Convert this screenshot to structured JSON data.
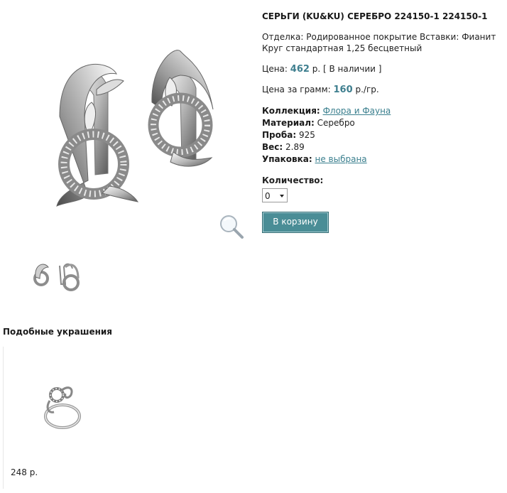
{
  "product": {
    "title": "СЕРЬГИ (KU&KU) СЕРЕБРО 224150-1 224150-1",
    "description": "Отделка: Родированное покрытие Вставки: Фианит Круг стандартная 1,25 бесцветный",
    "price_label": "Цена:",
    "price_value": "462",
    "price_unit": "р.",
    "availability": "[ В наличии ]",
    "per_gram_label": "Цена за грамм:",
    "per_gram_value": "160",
    "per_gram_unit": "р./гр."
  },
  "properties": {
    "collection_label": "Коллекция:",
    "collection_value": "Флора и Фауна",
    "material_label": "Материал:",
    "material_value": "Серебро",
    "probe_label": "Проба:",
    "probe_value": "925",
    "weight_label": "Вес:",
    "weight_value": "2.89",
    "package_label": "Упаковка:",
    "package_value": "не выбрана"
  },
  "order": {
    "quantity_label": "Количество:",
    "quantity_value": "0",
    "cart_button": "В корзину"
  },
  "similar": {
    "title": "Подобные украшения",
    "items": [
      {
        "price": "248 р."
      }
    ]
  },
  "colors": {
    "accent": "#4a8d96",
    "link": "#3a7f8e"
  },
  "icons": {
    "zoom": "magnifier-icon",
    "select_arrow": "chevron-down-icon"
  }
}
